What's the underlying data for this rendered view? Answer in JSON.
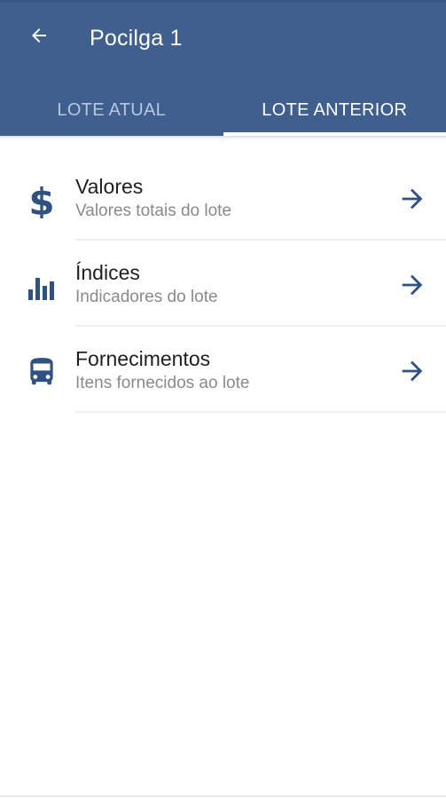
{
  "header": {
    "title": "Pocilga 1",
    "back_icon": "arrow-left-icon",
    "background_color": "#3f5f8f"
  },
  "tabs": [
    {
      "label": "LOTE ATUAL",
      "active": false
    },
    {
      "label": "LOTE ANTERIOR",
      "active": true
    }
  ],
  "menu": {
    "items": [
      {
        "title": "Valores",
        "subtitle": "Valores totais do lote",
        "icon": "dollar-icon",
        "action_icon": "arrow-right-icon"
      },
      {
        "title": "Índices",
        "subtitle": "Indicadores do lote",
        "icon": "bar-chart-icon",
        "action_icon": "arrow-right-icon"
      },
      {
        "title": "Fornecimentos",
        "subtitle": "Itens fornecidos ao lote",
        "icon": "bus-icon",
        "action_icon": "arrow-right-icon"
      }
    ]
  },
  "colors": {
    "primary": "#3f5f8f",
    "icon": "#2f5283",
    "title_text": "#1f1f1f",
    "subtitle_text": "#8a8a8a"
  }
}
